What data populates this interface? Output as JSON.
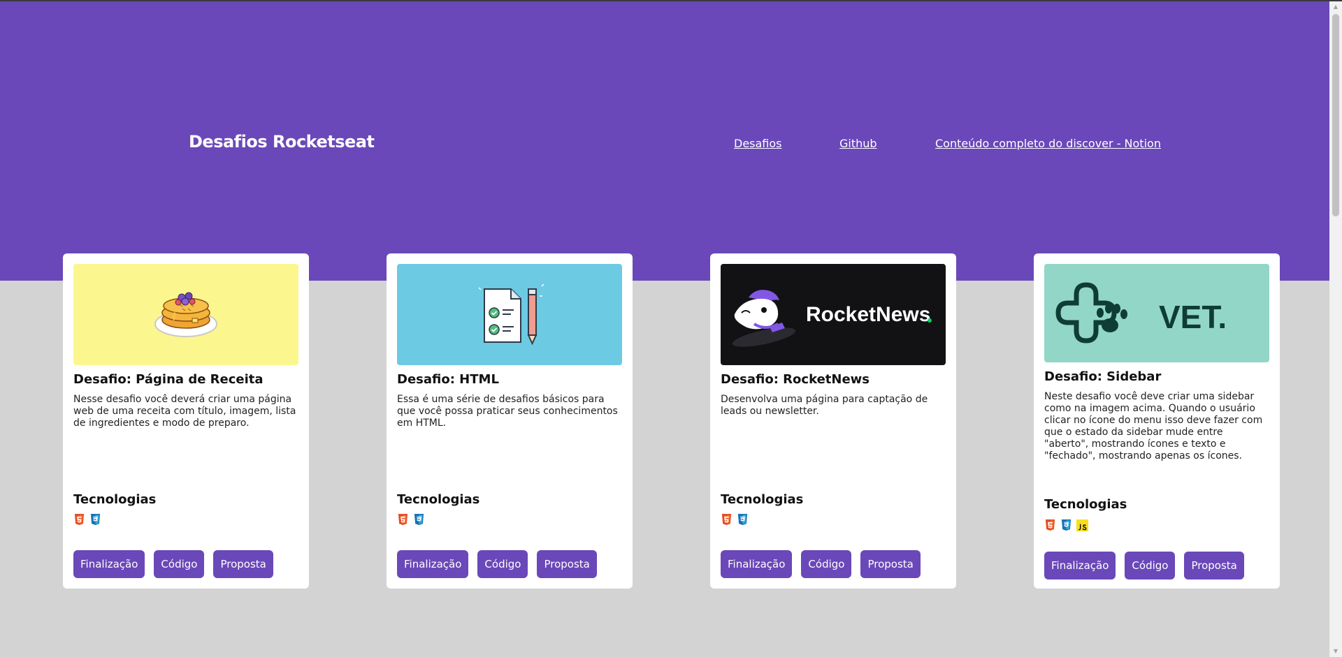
{
  "header": {
    "brand": "Desafios Rocketseat",
    "nav": [
      "Desafios",
      "Github",
      "Conteúdo completo do discover - Notion"
    ]
  },
  "colors": {
    "accent": "#6a48b9",
    "page_background": "#d3d3d3",
    "card_background": "#ffffff"
  },
  "cards": [
    {
      "image": "pancake-illustration",
      "title": "Desafio: Página de Receita",
      "description": "Nesse desafio você deverá criar uma página web de uma receita com título, imagem, lista de ingredientes e modo de preparo.",
      "tech_title": "Tecnologias",
      "technologies": [
        "html5-icon",
        "css3-icon"
      ],
      "buttons": [
        "Finalização",
        "Código",
        "Proposta"
      ]
    },
    {
      "image": "checklist-illustration",
      "title": "Desafio: HTML",
      "description": "Essa é uma série de desafios básicos para que você possa praticar seus conhecimentos em HTML.",
      "tech_title": "Tecnologias",
      "technologies": [
        "html5-icon",
        "css3-icon"
      ],
      "buttons": [
        "Finalização",
        "Código",
        "Proposta"
      ]
    },
    {
      "image": "rocketnews-banner",
      "image_text": "RocketNews",
      "title": "Desafio: RocketNews",
      "description": "Desenvolva uma página para captação de leads ou newsletter.",
      "tech_title": "Tecnologias",
      "technologies": [
        "html5-icon",
        "css3-icon"
      ],
      "buttons": [
        "Finalização",
        "Código",
        "Proposta"
      ]
    },
    {
      "image": "vet-banner",
      "image_text": "VET.",
      "title": "Desafio: Sidebar",
      "description": "Neste desafio você deve criar uma sidebar como na imagem acima. Quando o usuário clicar no ícone do menu isso deve fazer com que o estado da sidebar mude entre \"aberto\", mostrando ícones e texto e \"fechado\", mostrando apenas os ícones.",
      "tech_title": "Tecnologias",
      "technologies": [
        "html5-icon",
        "css3-icon",
        "javascript-icon"
      ],
      "buttons": [
        "Finalização",
        "Código",
        "Proposta"
      ]
    }
  ]
}
